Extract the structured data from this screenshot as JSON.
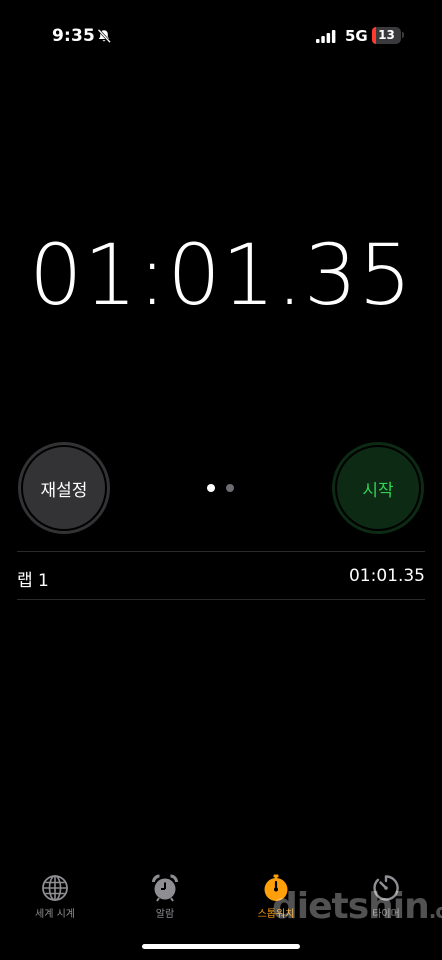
{
  "status_bar": {
    "time": "9:35",
    "network": "5G",
    "battery_level": "13",
    "battery_color": "#ff3b30"
  },
  "stopwatch": {
    "display": "01:01.35"
  },
  "buttons": {
    "reset_label": "재설정",
    "start_label": "시작",
    "start_color": "#30d158"
  },
  "pager": {
    "pages": 2,
    "current": 1
  },
  "laps": [
    {
      "label": "랩 1",
      "time": "01:01.35"
    }
  ],
  "tabs": [
    {
      "label": "세계 시계",
      "icon": "globe-icon",
      "active": false
    },
    {
      "label": "알람",
      "icon": "alarm-clock-icon",
      "active": false
    },
    {
      "label": "스톱워치",
      "icon": "stopwatch-icon",
      "active": true
    },
    {
      "label": "타이머",
      "icon": "timer-icon",
      "active": false
    }
  ],
  "accent_color": "#ff9f0a",
  "watermark": {
    "main": "dietshin",
    "suffix": ".com"
  }
}
